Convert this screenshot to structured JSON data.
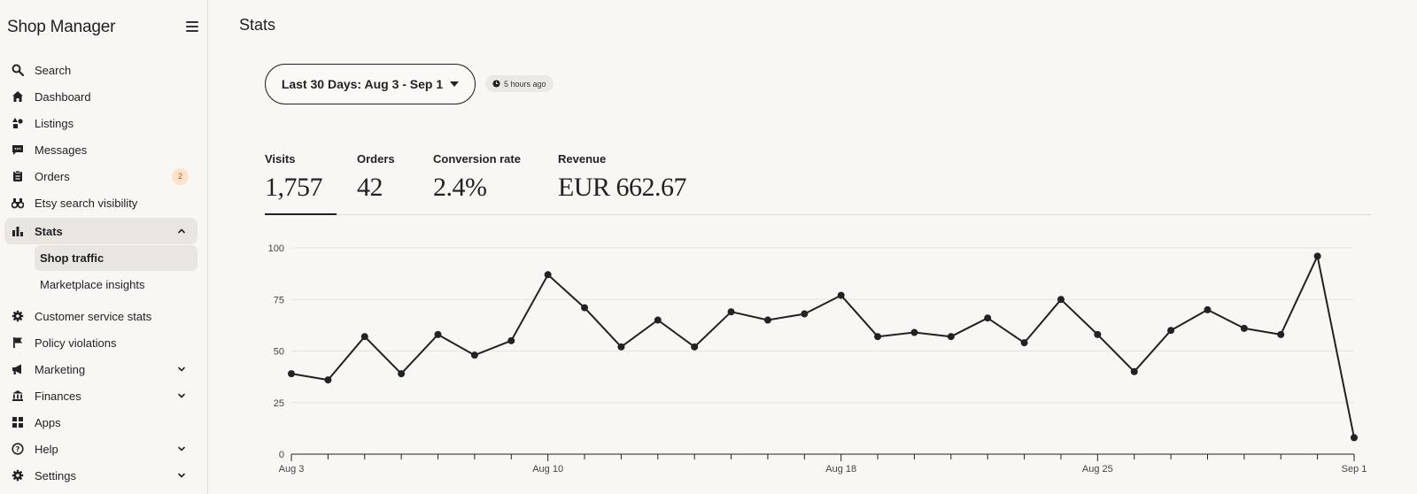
{
  "sidebar": {
    "title": "Shop Manager",
    "items": [
      {
        "label": "Search",
        "icon": "search-icon"
      },
      {
        "label": "Dashboard",
        "icon": "home-icon"
      },
      {
        "label": "Listings",
        "icon": "shapes-icon"
      },
      {
        "label": "Messages",
        "icon": "message-icon"
      },
      {
        "label": "Orders",
        "icon": "clipboard-icon",
        "badge": "2"
      },
      {
        "label": "Etsy search visibility",
        "icon": "binoculars-icon"
      },
      {
        "label": "Stats",
        "icon": "bar-chart-icon",
        "expanded": true
      },
      {
        "label": "Customer service stats",
        "icon": "gear-icon"
      },
      {
        "label": "Policy violations",
        "icon": "flag-icon"
      },
      {
        "label": "Marketing",
        "icon": "megaphone-icon"
      },
      {
        "label": "Finances",
        "icon": "bank-icon"
      },
      {
        "label": "Apps",
        "icon": "grid-icon"
      },
      {
        "label": "Help",
        "icon": "help-icon"
      },
      {
        "label": "Settings",
        "icon": "gear-icon"
      }
    ],
    "sub_items": [
      {
        "label": "Shop traffic",
        "active": true
      },
      {
        "label": "Marketplace insights",
        "active": false
      }
    ]
  },
  "main": {
    "title": "Stats",
    "date_range": "Last 30 Days: Aug 3 - Sep 1",
    "updated": "5 hours ago",
    "metrics": [
      {
        "label": "Visits",
        "value": "1,757"
      },
      {
        "label": "Orders",
        "value": "42"
      },
      {
        "label": "Conversion rate",
        "value": "2.4%"
      },
      {
        "label": "Revenue",
        "value": "EUR 662.67"
      }
    ]
  },
  "colors": {
    "accent": "#222222",
    "badge_bg": "#fde3cb",
    "badge_text": "#b35a14",
    "active_bg": "#e9e6e1"
  },
  "chart_data": {
    "type": "line",
    "title": "",
    "xlabel": "",
    "ylabel": "",
    "x": [
      "Aug 3",
      "Aug 4",
      "Aug 5",
      "Aug 6",
      "Aug 7",
      "Aug 8",
      "Aug 9",
      "Aug 10",
      "Aug 11",
      "Aug 12",
      "Aug 13",
      "Aug 14",
      "Aug 15",
      "Aug 16",
      "Aug 17",
      "Aug 18",
      "Aug 19",
      "Aug 20",
      "Aug 21",
      "Aug 22",
      "Aug 23",
      "Aug 24",
      "Aug 25",
      "Aug 26",
      "Aug 27",
      "Aug 28",
      "Aug 29",
      "Aug 30",
      "Aug 31",
      "Sep 1"
    ],
    "values": [
      39,
      36,
      57,
      39,
      58,
      48,
      55,
      87,
      71,
      52,
      65,
      52,
      69,
      65,
      68,
      77,
      57,
      59,
      57,
      66,
      54,
      75,
      58,
      40,
      60,
      70,
      61,
      58,
      96,
      8
    ],
    "x_tick_labels": [
      "Aug 3",
      "Aug 10",
      "Aug 18",
      "Aug 25",
      "Sep 1"
    ],
    "y_ticks": [
      0,
      25,
      50,
      75,
      100
    ],
    "ylim": [
      0,
      100
    ],
    "grid": true,
    "legend": "none"
  }
}
